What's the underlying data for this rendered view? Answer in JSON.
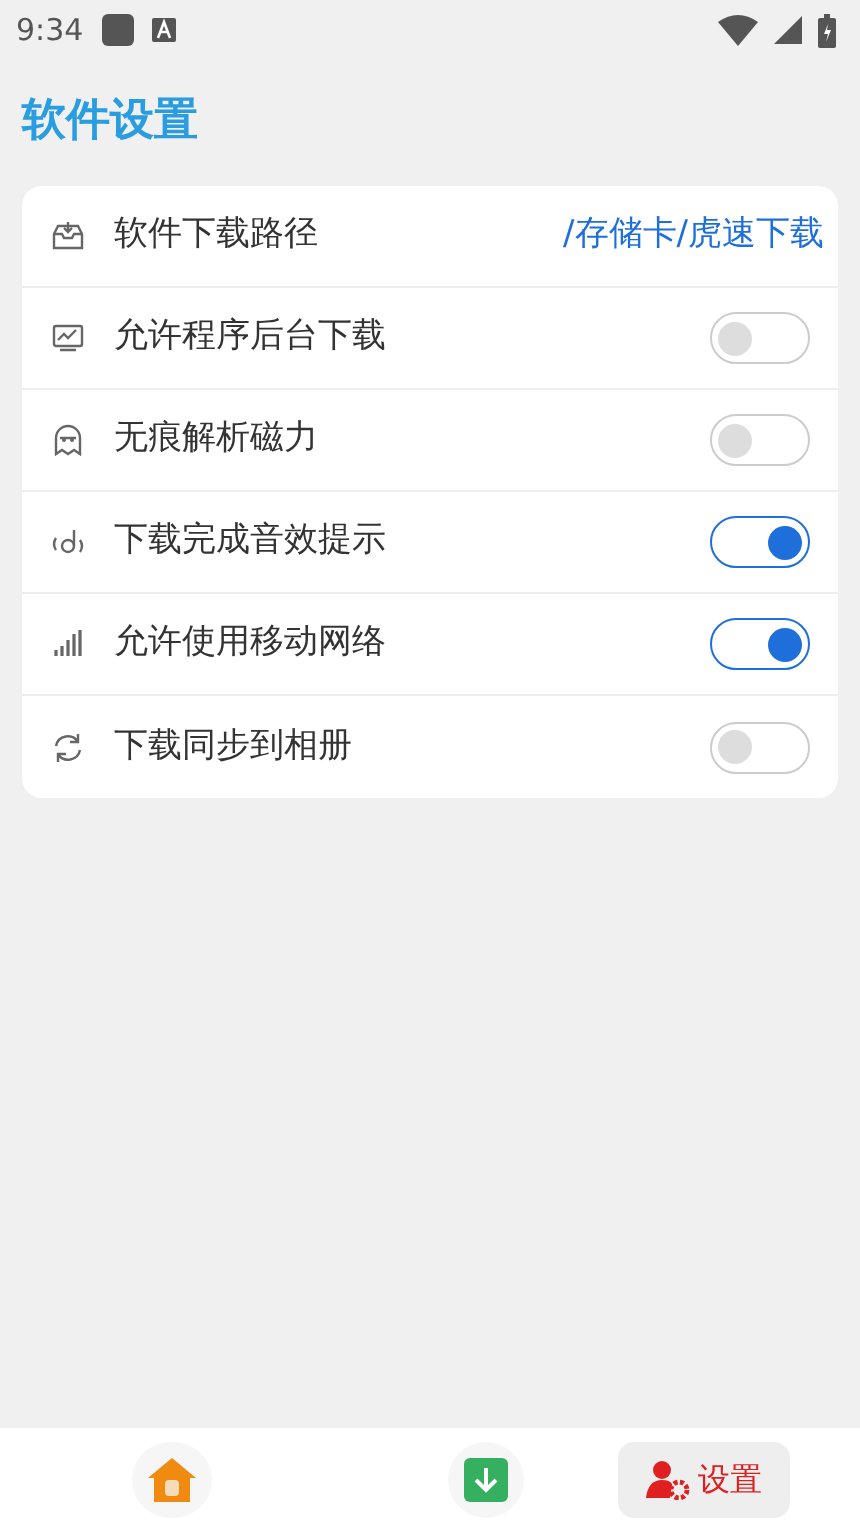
{
  "status_bar": {
    "time": "9:34"
  },
  "title": "软件设置",
  "settings": [
    {
      "kind": "link",
      "label": "软件下载路径",
      "value": "/存储卡/虎速下载"
    },
    {
      "kind": "switch",
      "label": "允许程序后台下载",
      "on": false
    },
    {
      "kind": "switch",
      "label": "无痕解析磁力",
      "on": false
    },
    {
      "kind": "switch",
      "label": "下载完成音效提示",
      "on": true
    },
    {
      "kind": "switch",
      "label": "允许使用移动网络",
      "on": true
    },
    {
      "kind": "switch",
      "label": "下载同步到相册",
      "on": false
    }
  ],
  "bottom_nav": [
    {
      "kind": "home",
      "selected": false
    },
    {
      "kind": "download",
      "selected": false
    },
    {
      "kind": "settings",
      "label": "设置",
      "selected": true
    }
  ]
}
